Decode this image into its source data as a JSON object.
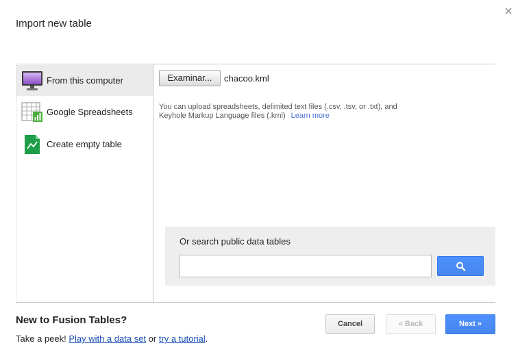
{
  "dialog": {
    "title": "Import new table",
    "close_glyph": "×"
  },
  "sidebar": {
    "items": [
      {
        "label": "From this computer",
        "icon": "monitor-icon",
        "selected": true
      },
      {
        "label": "Google Spreadsheets",
        "icon": "spreadsheet-icon",
        "selected": false
      },
      {
        "label": "Create empty table",
        "icon": "new-table-icon",
        "selected": false
      }
    ]
  },
  "upload": {
    "browse_label": "Examinar...",
    "file_name": "chacoo.kml",
    "help_text": "You can upload spreadsheets, delimited text files (.csv, .tsv, or .txt), and Keyhole Markup Language files (.kml)",
    "learn_more": "Learn more"
  },
  "search": {
    "label": "Or search public data tables",
    "placeholder": "",
    "icon": "search-icon"
  },
  "footer": {
    "title": "New to Fusion Tables?",
    "prefix": "Take a peek! ",
    "link1": "Play with a data set",
    "middle": " or ",
    "link2": "try a tutorial",
    "suffix": "."
  },
  "buttons": {
    "cancel": "Cancel",
    "back": "« Back",
    "next": "Next »"
  },
  "colors": {
    "accent": "#4d90fe",
    "link": "#1a4fb4",
    "selected_bg": "#ebebeb"
  }
}
